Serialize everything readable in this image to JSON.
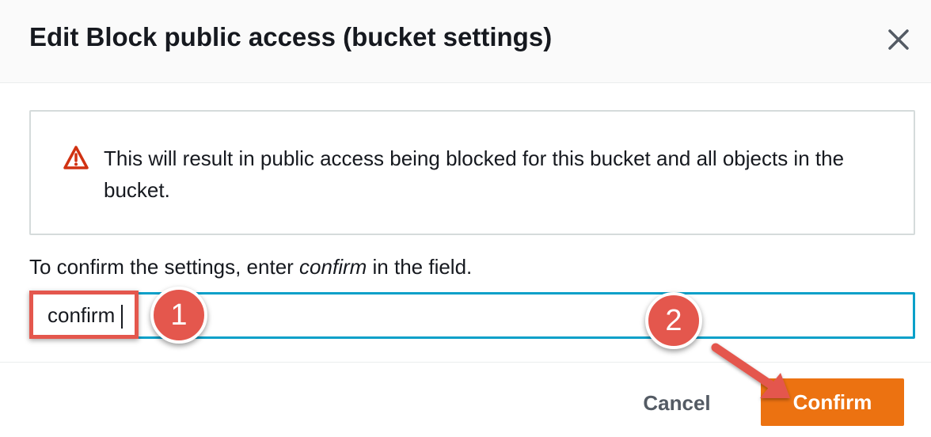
{
  "modal": {
    "title": "Edit Block public access (bucket settings)",
    "close_icon": "close-icon"
  },
  "alert": {
    "icon": "warning-triangle-icon",
    "message": "This will result in public access being blocked for this bucket and all objects in the bucket."
  },
  "confirm_field": {
    "label_prefix": "To confirm the settings, enter ",
    "label_keyword": "confirm",
    "label_suffix": " in the field.",
    "value": "confirm"
  },
  "annotations": {
    "step1": "1",
    "step2": "2"
  },
  "footer": {
    "cancel_label": "Cancel",
    "confirm_label": "Confirm"
  },
  "colors": {
    "primary_button": "#ec7211",
    "input_focus": "#0aa0c9",
    "annotation": "#e4574d",
    "warning": "#d13212"
  }
}
